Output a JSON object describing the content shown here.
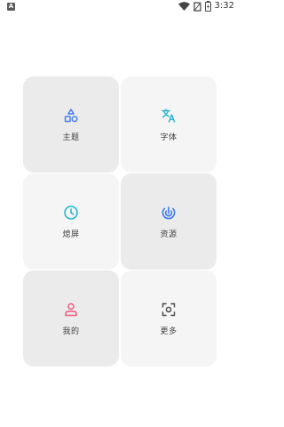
{
  "status_bar": {
    "notification_icon_letter": "A",
    "time": "3:32",
    "icons": [
      "wifi-icon",
      "no-sim-icon",
      "battery-icon"
    ]
  },
  "tiles": [
    {
      "label": "主题",
      "icon": "theme-shapes-icon",
      "icon_color": "#4a7df0",
      "tone": "dark"
    },
    {
      "label": "字体",
      "icon": "font-translate-icon",
      "icon_color": "#27b5c9",
      "tone": "light"
    },
    {
      "label": "熄屏",
      "icon": "clock-icon",
      "icon_color": "#1fb5c8",
      "tone": "light"
    },
    {
      "label": "资源",
      "icon": "resource-spiral-icon",
      "icon_color": "#3d78f2",
      "tone": "dark"
    },
    {
      "label": "我的",
      "icon": "person-icon",
      "icon_color": "#ef5a7a",
      "tone": "dark"
    },
    {
      "label": "更多",
      "icon": "scan-more-icon",
      "icon_color": "#444444",
      "tone": "light"
    }
  ]
}
